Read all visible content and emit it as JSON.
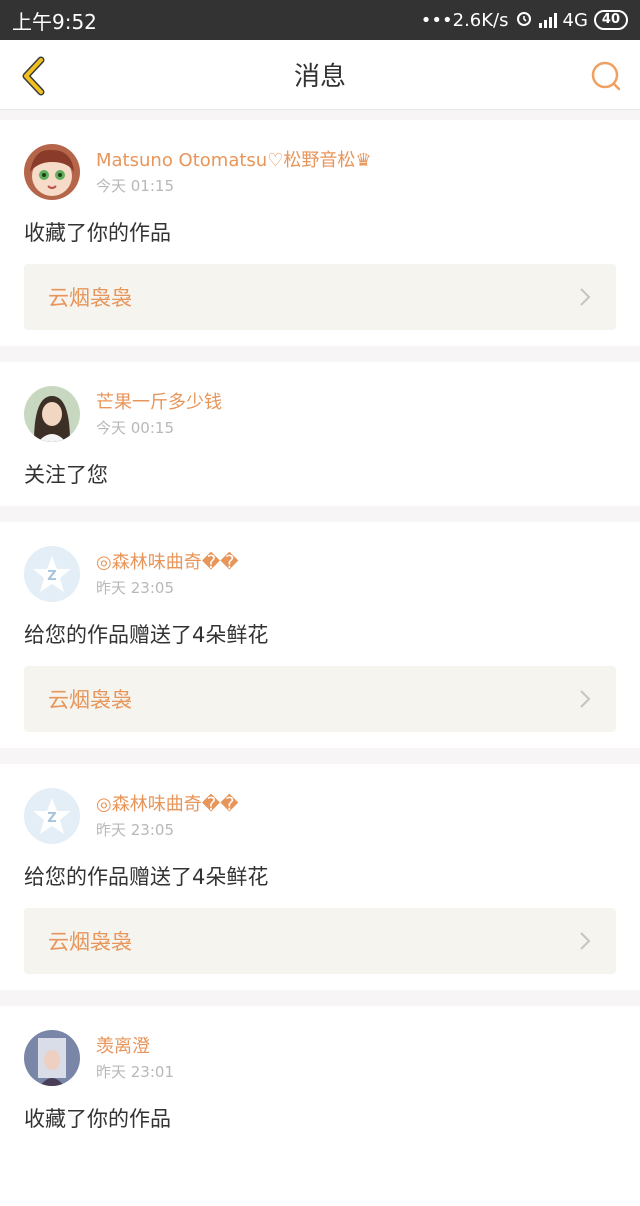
{
  "status_bar": {
    "time": "上午9:52",
    "network_speed": "•••2.6K/s",
    "network_type": "4G",
    "battery": "40"
  },
  "header": {
    "title": "消息"
  },
  "colors": {
    "accent": "#e8955a",
    "status_bar_bg": "#333333",
    "back_icon": "#f0c020"
  },
  "messages": [
    {
      "username": "Matsuno Otomatsu♡松野音松♛",
      "time": "今天 01:15",
      "action": "收藏了你的作品",
      "work_title": "云烟袅袅",
      "avatar_icon": "anime-avatar"
    },
    {
      "username": "芒果一斤多少钱",
      "time": "今天 00:15",
      "action": "关注了您",
      "avatar_icon": "photo-avatar"
    },
    {
      "username": "◎森林味曲奇��",
      "time": "昨天 23:05",
      "action": "给您的作品赠送了4朵鲜花",
      "work_title": "云烟袅袅",
      "avatar_icon": "default-avatar"
    },
    {
      "username": "◎森林味曲奇��",
      "time": "昨天 23:05",
      "action": "给您的作品赠送了4朵鲜花",
      "work_title": "云烟袅袅",
      "avatar_icon": "default-avatar"
    },
    {
      "username": "羡离澄",
      "time": "昨天 23:01",
      "action": "收藏了你的作品",
      "avatar_icon": "photo-avatar"
    }
  ]
}
